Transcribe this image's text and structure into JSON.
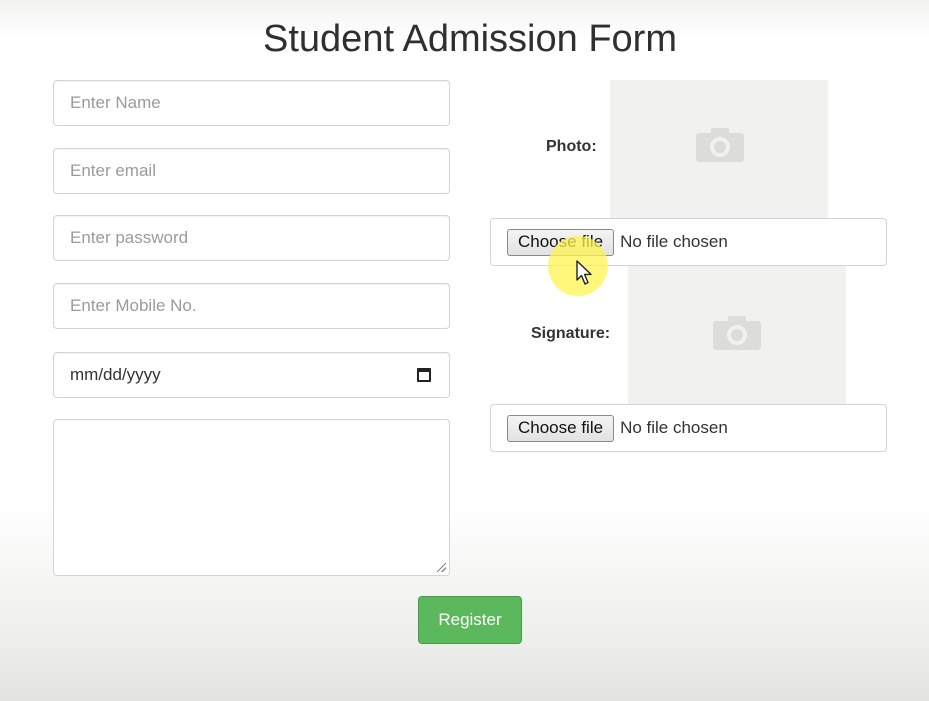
{
  "form": {
    "title": "Student Admission Form",
    "name_placeholder": "Enter Name",
    "email_placeholder": "Enter email",
    "password_placeholder": "Enter password",
    "mobile_placeholder": "Enter Mobile No.",
    "date_value": "mm/dd/yyyy",
    "photo_label": "Photo:",
    "signature_label": "Signature:",
    "choose_file_label": "Choose file",
    "no_file_text": "No file chosen",
    "register_label": "Register"
  },
  "icons": {
    "photo_placeholder": "camera-icon",
    "signature_placeholder": "camera-icon",
    "date_picker": "calendar-icon",
    "pointer": "mouse-cursor-icon"
  },
  "colors": {
    "register_button": "#5cb85c",
    "cursor_highlight": "#fff450"
  }
}
